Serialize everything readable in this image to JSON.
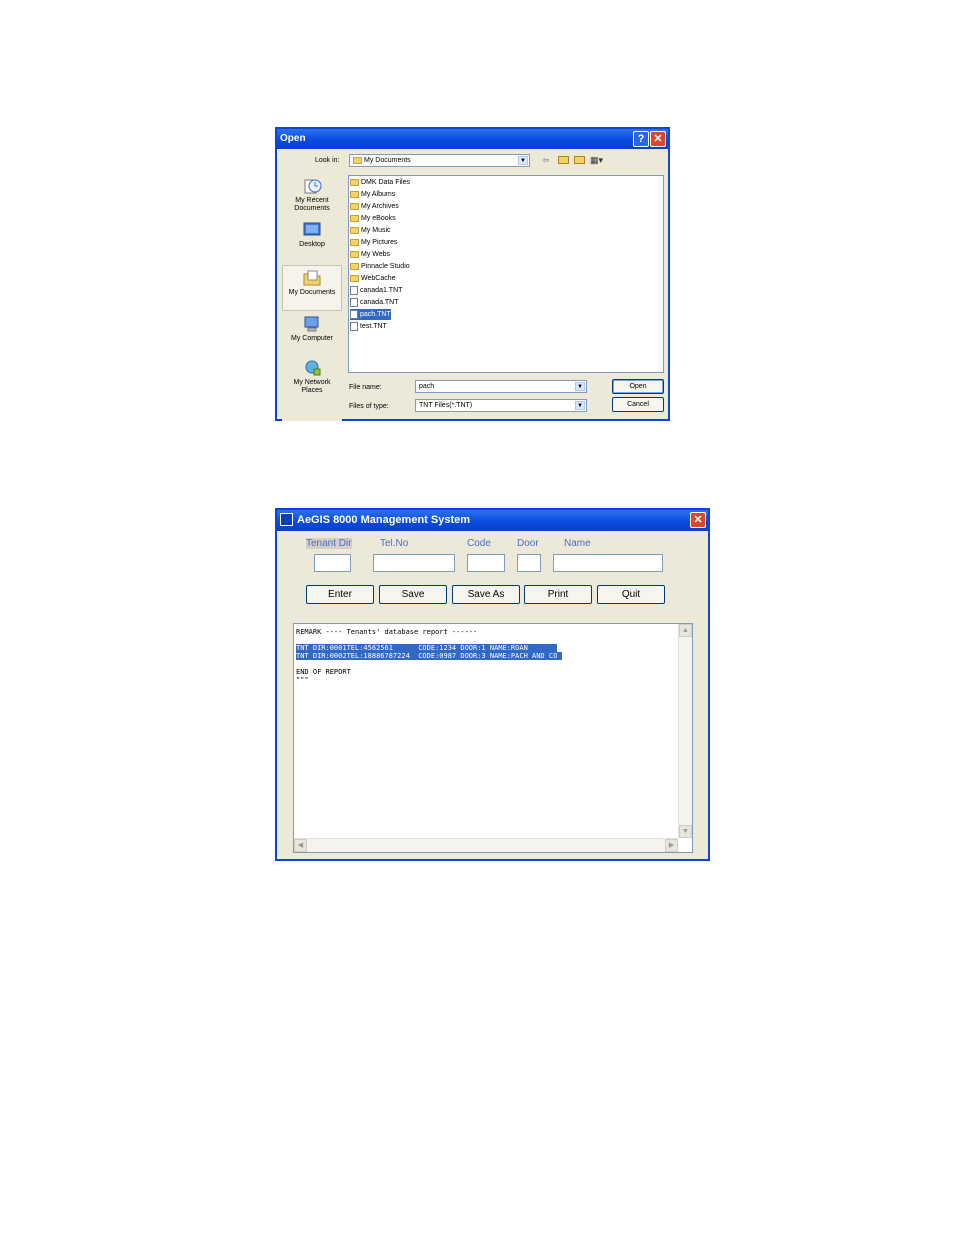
{
  "open_dialog": {
    "title": "Open",
    "look_in_label": "Look in:",
    "look_in_value": "My Documents",
    "places": [
      {
        "label": "My Recent\nDocuments"
      },
      {
        "label": "Desktop"
      },
      {
        "label": "My Documents"
      },
      {
        "label": "My Computer"
      },
      {
        "label": "My Network\nPlaces"
      }
    ],
    "files": [
      {
        "name": "DMK Data Files",
        "type": "folder"
      },
      {
        "name": "My Albums",
        "type": "folder"
      },
      {
        "name": "My Archives",
        "type": "folder"
      },
      {
        "name": "My eBooks",
        "type": "folder"
      },
      {
        "name": "My Music",
        "type": "folder"
      },
      {
        "name": "My Pictures",
        "type": "folder"
      },
      {
        "name": "My Webs",
        "type": "folder"
      },
      {
        "name": "Pinnacle Studio",
        "type": "folder"
      },
      {
        "name": "WebCache",
        "type": "folder"
      },
      {
        "name": "canada1.TNT",
        "type": "doc"
      },
      {
        "name": "canada.TNT",
        "type": "doc"
      },
      {
        "name": "pach.TNT",
        "type": "doc",
        "selected": true
      },
      {
        "name": "test.TNT",
        "type": "doc"
      }
    ],
    "file_name_label": "File name:",
    "file_name_value": "pach",
    "files_of_type_label": "Files of type:",
    "files_of_type_value": "TNT Files(*.TNT)",
    "open_button": "Open",
    "cancel_button": "Cancel"
  },
  "aegis": {
    "title": "AeGIS 8000 Management System",
    "fields": {
      "tenant_dir": "Tenant Dir",
      "tel_no": "Tel.No",
      "code": "Code",
      "door": "Door",
      "name": "Name"
    },
    "buttons": {
      "enter": "Enter",
      "save": "Save",
      "save_as": "Save As",
      "print": "Print",
      "quit": "Quit"
    },
    "report_lines": [
      {
        "text": "REMARK ---- Tenants' database report ------",
        "selected": false
      },
      {
        "text": "",
        "selected": false
      },
      {
        "text": "TNT DIR:0001TEL:4562561      CODE:1234 DOOR:1 NAME:ROAN       ",
        "selected": true
      },
      {
        "text": "TNT DIR:0002TEL:18886787224  CODE:0987 DOOR:3 NAME:PACH AND CO ",
        "selected": true
      },
      {
        "text": "",
        "selected": false
      },
      {
        "text": "END OF REPORT",
        "selected": false
      },
      {
        "text": "\"\"\"",
        "selected": false
      }
    ]
  }
}
